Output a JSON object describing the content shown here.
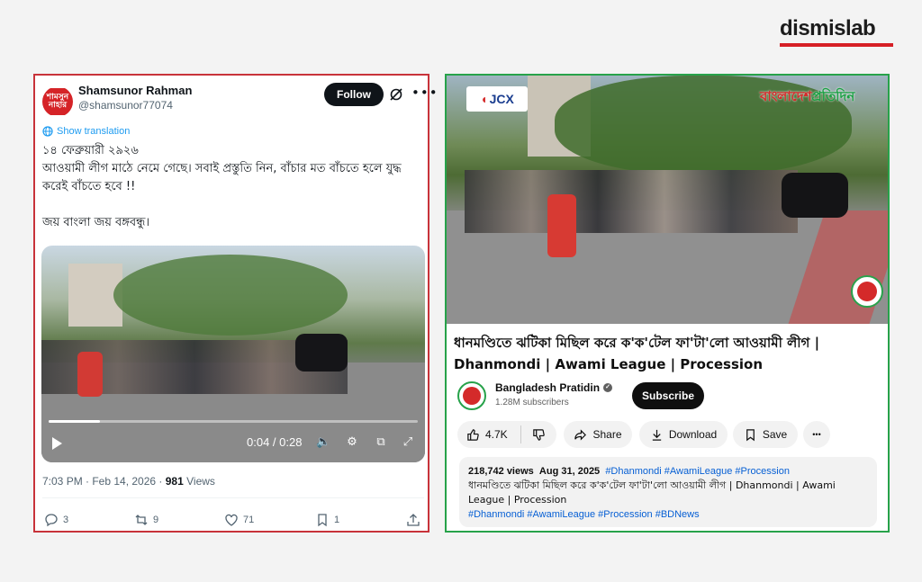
{
  "brand": {
    "name": "dismislab"
  },
  "tweet": {
    "avatar_text": "শামসুন নাহার",
    "user_name": "Shamsunor Rahman",
    "handle": "@shamsunor77074",
    "follow_label": "Follow",
    "show_translation": "Show translation",
    "text": "১৪ ফেব্রুয়ারী ২৯২৬\nআওয়ামী লীগ মাঠে নেমে গেছে। সবাই প্রস্তুতি নিন, বাঁচার মত বাঁচতে হলে যুদ্ধ করেই বাঁচতে হবে !!\n\nজয় বাংলা জয় বঙ্গবন্ধু।",
    "video": {
      "time": "0:04 / 0:28",
      "progress": 0.14
    },
    "timestamp": "7:03 PM · Feb 14, 2026 · ",
    "views_count": "981",
    "views_label": " Views",
    "actions": {
      "replies": "3",
      "reposts": "9",
      "likes": "71",
      "bookmarks": "1"
    }
  },
  "youtube": {
    "watermark_jcx": "JCX",
    "watermark_bp_red": "বাংলাদেশ",
    "watermark_bp_green": "প্রতিদিন",
    "title": "ধানমণ্ডিতে ঝটিকা মিছিল করে ক'ক'টেল ফা'টা'লো আওয়ামী লীগ | Dhanmondi | Awami League | Procession",
    "channel_name": "Bangladesh Pratidin",
    "subscribers": "1.28M subscribers",
    "subscribe_label": "Subscribe",
    "likes": "4.7K",
    "share_label": "Share",
    "download_label": "Download",
    "save_label": "Save",
    "more_label": "•••",
    "desc_views": "218,742 views",
    "desc_date": "Aug 31, 2025",
    "desc_tags_top": "#Dhanmondi #AwamiLeague #Procession",
    "desc_body": "ধানমণ্ডিতে ঝটিকা মিছিল করে ক'ক'টেল ফা'টা'লো আওয়ামী লীগ | Dhanmondi | Awami League | Procession",
    "desc_tags_bottom": "#Dhanmondi #AwamiLeague #Procession #BDNews"
  },
  "colors": {
    "left_border": "#c8333a",
    "right_border": "#27a24a",
    "twitter_blue": "#1d9bf0",
    "youtube_link": "#065fd4"
  }
}
